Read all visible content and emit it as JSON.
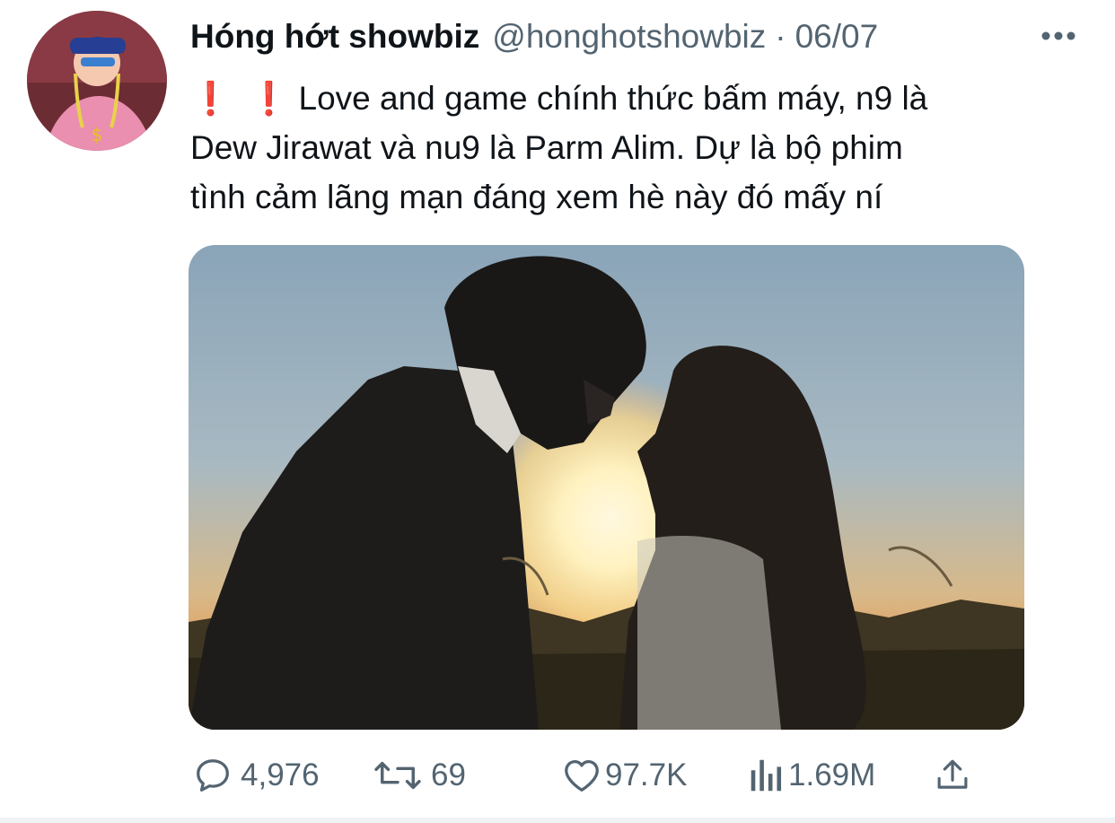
{
  "tweet": {
    "author_name": "Hóng hớt showbiz",
    "author_handle": "@honghotshowbiz",
    "separator": "·",
    "date": "06/07",
    "text_lines": [
      "Love and game chính thức bấm máy, n9 là",
      "Dew Jirawat và nu9 là Parm Alim. Dự là bộ phim",
      "tình cảm lãng mạn đáng xem hè này đó mấy ní"
    ],
    "leading_emoji": [
      "❗",
      "❗"
    ],
    "media_icon": "photo-silhouette-couple-sunset"
  },
  "actions": {
    "reply": {
      "icon": "reply-icon",
      "count": "4,976"
    },
    "retweet": {
      "icon": "retweet-icon",
      "count": "69"
    },
    "like": {
      "icon": "heart-icon",
      "count": "97.7K"
    },
    "views": {
      "icon": "analytics-icon",
      "count": "1.69M"
    },
    "share": {
      "icon": "share-icon"
    }
  },
  "colors": {
    "text": "#0f1419",
    "secondary": "#536471",
    "emoji_red": "#e0201b"
  }
}
